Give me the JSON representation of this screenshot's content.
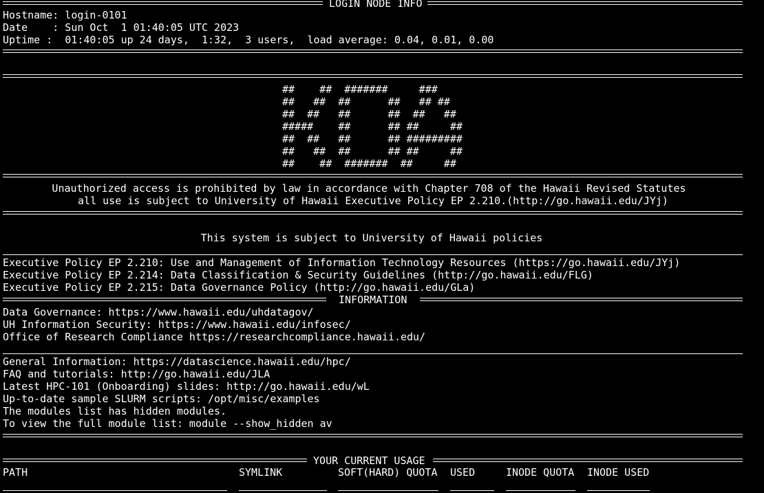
{
  "login_node": {
    "title": " LOGIN NODE INFO ",
    "hostname": "Hostname: login-0101",
    "date": "Date    : Sun Oct  1 01:40:05 UTC 2023",
    "uptime": "Uptime :  01:40:05 up 24 days,  1:32,  3 users,  load average: 0.04, 0.01, 0.00"
  },
  "ascii_art": [
    "##    ##  #######     ###",
    "##   ##  ##      ##   ## ##",
    "##  ##   ##      ##  ##   ##",
    "#####    ##      ## ##     ##",
    "##  ##   ##      ## #########",
    "##   ##  ##      ## ##     ##",
    "##    ##  #######  ##     ##"
  ],
  "legal": {
    "line1": "Unauthorized access is prohibited by law in accordance with Chapter 708 of the Hawaii Revised Statutes",
    "line2": "all use is subject to University of Hawaii Executive Policy EP 2.210.(http://go.hawaii.edu/JYj)"
  },
  "policies": {
    "heading": "This system is subject to University of Hawaii policies",
    "items": [
      "Executive Policy EP 2.210: Use and Management of Information Technology Resources (https://go.hawaii.edu/JYj)",
      "Executive Policy EP 2.214: Data Classification & Security Guidelines (http://go.hawaii.edu/FLG)",
      "Executive Policy EP 2.215: Data Governance Policy (http://go.hawaii.edu/GLa)"
    ]
  },
  "information": {
    "title": " INFORMATION ",
    "links": [
      "Data Governance: https://www.hawaii.edu/uhdatagov/",
      "UH Information Security: https://www.hawaii.edu/infosec/",
      "Office of Research Compliance https://researchcompliance.hawaii.edu/"
    ],
    "general": [
      "General Information: https://datascience.hawaii.edu/hpc/",
      "FAQ and tutorials: http://go.hawaii.edu/JLA",
      "Latest HPC-101 (Onboarding) slides: http://go.hawaii.edu/wL",
      "Up-to-date sample SLURM scripts: /opt/misc/examples",
      "The modules list has hidden modules.",
      "To view the full module list: module --show_hidden av"
    ]
  },
  "usage": {
    "title": " YOUR CURRENT USAGE ",
    "columns": {
      "path": "PATH",
      "symlink": "SYMLINK",
      "soft_hard_quota": "SOFT(HARD) QUOTA",
      "used": "USED",
      "inode_quota": "INODE QUOTA",
      "inode_used": "INODE USED"
    }
  },
  "colors": {
    "background": "#000000",
    "foreground": "#ffffff"
  }
}
